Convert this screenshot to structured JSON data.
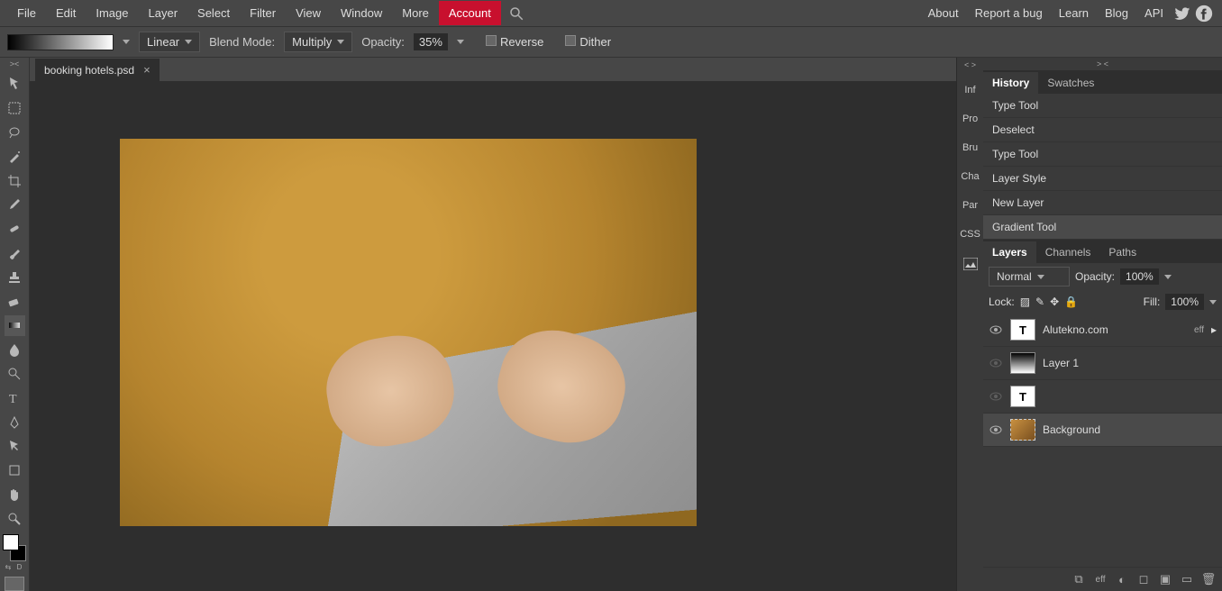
{
  "menubar": {
    "items": [
      "File",
      "Edit",
      "Image",
      "Layer",
      "Select",
      "Filter",
      "View",
      "Window",
      "More"
    ],
    "account": "Account",
    "right": [
      "About",
      "Report a bug",
      "Learn",
      "Blog",
      "API"
    ]
  },
  "optionbar": {
    "grad_type": "Linear",
    "blend_label": "Blend Mode:",
    "blend_value": "Multiply",
    "opacity_label": "Opacity:",
    "opacity_value": "35%",
    "reverse": "Reverse",
    "dither": "Dither"
  },
  "document": {
    "tab": "booking hotels.psd"
  },
  "minipanels": [
    "Inf",
    "Pro",
    "Bru",
    "Cha",
    "Par",
    "CSS"
  ],
  "history": {
    "tabs": [
      "History",
      "Swatches"
    ],
    "items": [
      "Type Tool",
      "Deselect",
      "Type Tool",
      "Layer Style",
      "New Layer",
      "Gradient Tool"
    ]
  },
  "layers": {
    "tabs": [
      "Layers",
      "Channels",
      "Paths"
    ],
    "blend": "Normal",
    "opacity_label": "Opacity:",
    "opacity_value": "100%",
    "lock_label": "Lock:",
    "fill_label": "Fill:",
    "fill_value": "100%",
    "items": [
      {
        "name": "Alutekno.com",
        "eff": "eff",
        "type": "T",
        "visible": true
      },
      {
        "name": "Layer 1",
        "type": "grad",
        "visible": false
      },
      {
        "name": "",
        "type": "T",
        "visible": false
      },
      {
        "name": "Background",
        "type": "img",
        "visible": true
      }
    ]
  }
}
